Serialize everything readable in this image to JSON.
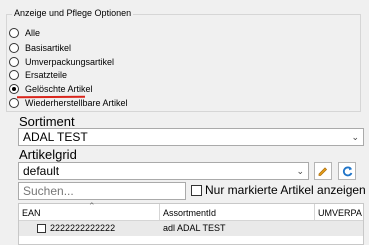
{
  "options_group": {
    "legend": "Anzeige und Pflege Optionen",
    "options": [
      {
        "label": "Alle",
        "checked": false
      },
      {
        "label": "Basisartikel",
        "checked": false
      },
      {
        "label": "Umverpackungsartikel",
        "checked": false
      },
      {
        "label": "Ersatzteile",
        "checked": false
      },
      {
        "label": "Gelöschte Artikel",
        "checked": true
      },
      {
        "label": "Wiederherstellbare Artikel",
        "checked": false
      }
    ]
  },
  "sortiment": {
    "label": "Sortiment",
    "value": "ADAL TEST"
  },
  "artikelgrid": {
    "label": "Artikelgrid",
    "value": "default"
  },
  "search": {
    "placeholder": "Suchen...",
    "value": ""
  },
  "only_marked": {
    "label": "Nur markierte Artikel anzeigen",
    "checked": false
  },
  "grid": {
    "columns": [
      "EAN",
      "AssortmentId",
      "UMVERPA"
    ],
    "rows": [
      {
        "ean": "2222222222222",
        "assortment_id": "adl ADAL TEST",
        "umverpa": ""
      }
    ]
  },
  "colors": {
    "annotation_line": "#d9261c",
    "edit_icon": "#e8a21a",
    "refresh_icon": "#1f74c8"
  },
  "icons": {
    "edit": "pencil-icon",
    "refresh": "refresh-icon",
    "dropdown": "chevron-down-icon",
    "sort": "sort-up-icon"
  }
}
